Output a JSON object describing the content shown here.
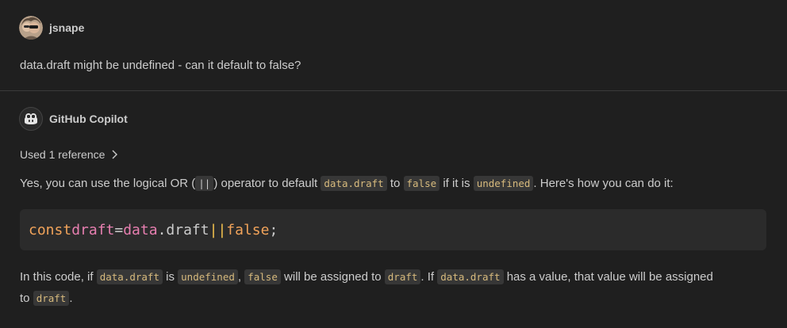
{
  "user_message": {
    "username": "jsnape",
    "text": "data.draft might be undefined - can it default to false?"
  },
  "assistant_message": {
    "name": "GitHub Copilot",
    "references_label": "Used 1 reference",
    "para1": {
      "t1": "Yes, you can use the logical OR (",
      "c1": "||",
      "t2": ") operator to default ",
      "c2": "data.draft",
      "t3": " to ",
      "c3": "false",
      "t4": " if it is ",
      "c4": "undefined",
      "t5": ". Here's how you can do it:"
    },
    "code": {
      "kw": "const",
      "var": "draft",
      "eq": "=",
      "obj": "data",
      "prop": ".draft",
      "or": "||",
      "lit": "false",
      "end": ";"
    },
    "para2": {
      "t1": "In this code, if ",
      "c1": "data.draft",
      "t2": " is ",
      "c2": "undefined",
      "t3": ", ",
      "c3": "false",
      "t4": " will be assigned to ",
      "c4": "draft",
      "t5": ". If ",
      "c5": "data.draft",
      "t6": " has a value, that value will be assigned",
      "t7": "to ",
      "c6": "draft",
      "t8": "."
    }
  },
  "icons": {
    "user_avatar": "user-avatar-photo",
    "copilot_avatar": "copilot-icon",
    "references_chevron": "chevron-right-icon"
  },
  "colors": {
    "background": "#1f1f1f",
    "text": "#cccccc",
    "inline_code_bg": "#373737",
    "inline_code_text": "#d7ba7d",
    "code_block_bg": "#2b2b2b",
    "keyword": "#f1a35a",
    "identifier": "#e77fb0",
    "or_operator": "#f2c14e"
  }
}
